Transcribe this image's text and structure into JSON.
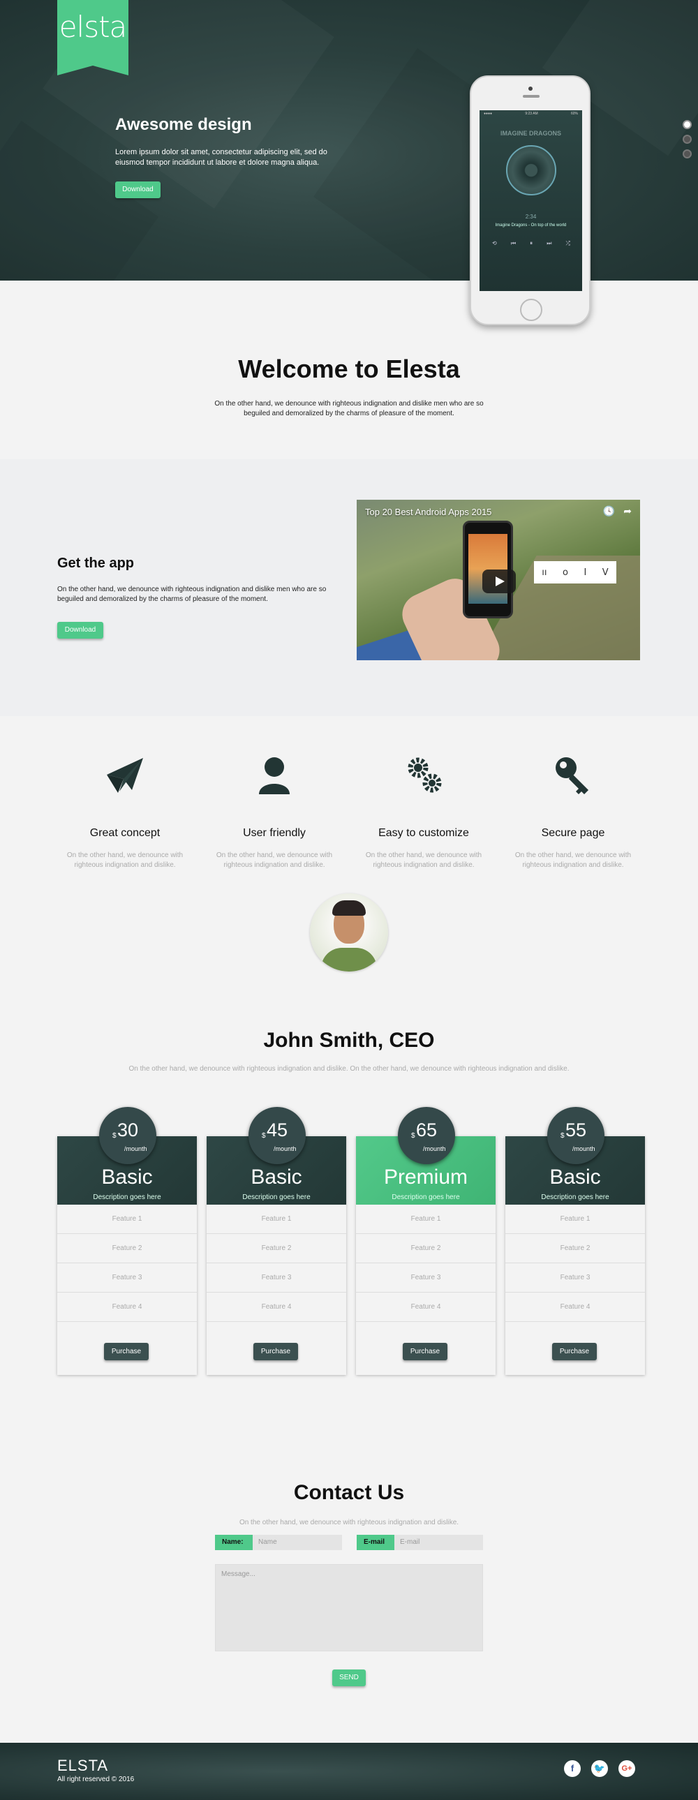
{
  "hero": {
    "logo": "elsta",
    "title": "Awesome design",
    "text": "Lorem ipsum dolor sit amet, consectetur adipiscing elit, sed do eiusmod tempor incididunt ut labore et dolore magna aliqua.",
    "button": "Download",
    "phone": {
      "band": "IMAGINE DRAGONS",
      "time": "2:34",
      "song": "Imagine Dragons - On top of the world",
      "status_time": "9:23 AM",
      "status_battery": "60%"
    }
  },
  "welcome": {
    "title": "Welcome to Elesta",
    "text": "On the other hand, we denounce with righteous indignation and dislike men who are so beguiled and demoralized by the charms of pleasure of the moment."
  },
  "getapp": {
    "title": "Get the app",
    "text": "On the other hand, we denounce with righteous indignation and dislike men who are so beguiled and demoralized by the charms of pleasure of the moment.",
    "button": "Download",
    "video_title": "Top 20 Best Android Apps 2015",
    "video_sign": [
      "ıı",
      "o",
      "I",
      "V"
    ]
  },
  "features": [
    {
      "title": "Great concept",
      "text": "On the other hand, we denounce with righteous indignation and dislike."
    },
    {
      "title": "User friendly",
      "text": "On the other hand, we denounce with righteous indignation and dislike."
    },
    {
      "title": "Easy to customize",
      "text": "On the other hand, we denounce with righteous indignation and dislike."
    },
    {
      "title": "Secure page",
      "text": "On the other hand, we denounce with righteous indignation and dislike."
    }
  ],
  "ceo": {
    "name": "John Smith, CEO",
    "text": "On the other hand, we denounce with righteous indignation and dislike. On the other hand, we denounce with righteous indignation and dislike."
  },
  "pricing": {
    "currency": "$",
    "period": "/mounth",
    "desc": "Description goes here",
    "purchase": "Purchase",
    "features": [
      "Feature 1",
      "Feature 2",
      "Feature 3",
      "Feature 4"
    ],
    "plans": [
      {
        "name": "Basic",
        "price": "30"
      },
      {
        "name": "Basic",
        "price": "45"
      },
      {
        "name": "Premium",
        "price": "65",
        "highlight": true
      },
      {
        "name": "Basic",
        "price": "55"
      }
    ],
    "colors": {
      "dark": "#2b403e",
      "accent": "#4fc98a"
    }
  },
  "contact": {
    "title": "Contact Us",
    "text": "On the other hand, we denounce with righteous indignation and dislike.",
    "name_label": "Name:",
    "name_placeholder": "Name",
    "email_label": "E-mail",
    "email_placeholder": "E-mail",
    "message_placeholder": "Message...",
    "send": "SEND"
  },
  "footer": {
    "brand": "ELSTA",
    "copy": "All right reserved © 2016",
    "social": [
      "facebook-icon",
      "twitter-icon",
      "google-plus-icon"
    ]
  }
}
